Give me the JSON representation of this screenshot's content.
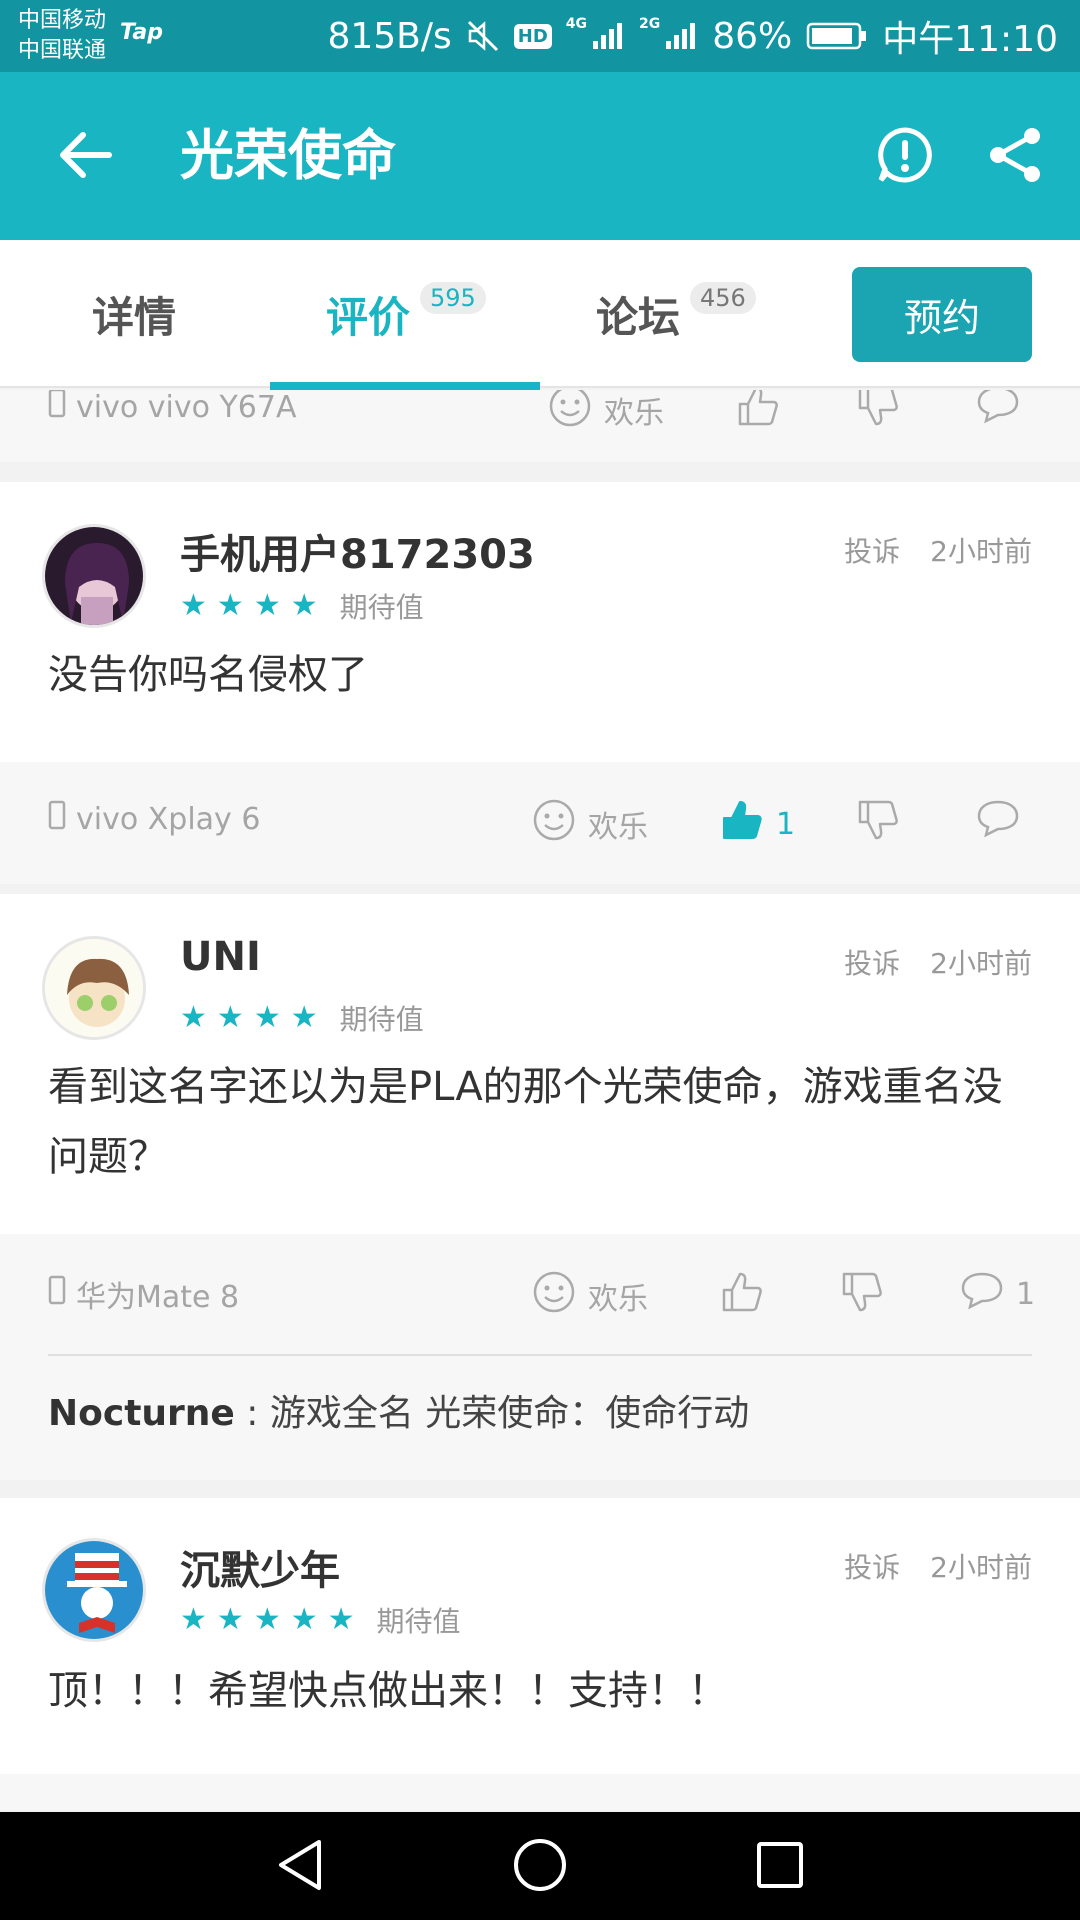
{
  "status_bar": {
    "carrier_1": "中国移动",
    "carrier_2": "中国联通",
    "app_badge": "Tap",
    "net_speed": "815B/s",
    "hd_label": "HD",
    "sig1_label": "4G",
    "sig2_label": "2G",
    "battery": "86%",
    "time": "中午11:10"
  },
  "header": {
    "title": "光荣使命",
    "back_icon": "arrow-left-icon",
    "report_icon": "exclamation-circle-icon",
    "share_icon": "share-icon"
  },
  "tabs": [
    {
      "label": "详情"
    },
    {
      "label": "评价",
      "count": "595"
    },
    {
      "label": "论坛",
      "count": "456"
    }
  ],
  "reserve_label": "预约",
  "reaction_label": "欢乐",
  "partial_footer": {
    "device": "vivo vivo Y67A"
  },
  "reviews": [
    {
      "user": "手机用户8172303",
      "rating_label": "期待值",
      "stars": 4,
      "report": "投诉",
      "time": "2小时前",
      "content": "没告你吗名侵权了",
      "device": "vivo Xplay 6",
      "likes": "1"
    },
    {
      "user": "UNI",
      "rating_label": "期待值",
      "stars": 4,
      "report": "投诉",
      "time": "2小时前",
      "content": "看到这名字还以为是PLA的那个光荣使命，游戏重名没问题？",
      "device": "华为Mate 8",
      "comments": "1",
      "reply_user": "Nocturne",
      "reply_text": " : 游戏全名 光荣使命：使命行动"
    },
    {
      "user": "沉默少年",
      "rating_label": "期待值",
      "stars": 5,
      "report": "投诉",
      "time": "2小时前",
      "content": "顶！！！希望快点做出来！！支持！！"
    }
  ],
  "colors": {
    "status_bg": "#1395a1",
    "header_bg": "#1ab5c2",
    "accent": "#1ab5c2",
    "reserve_bg": "#1ba5b2"
  }
}
